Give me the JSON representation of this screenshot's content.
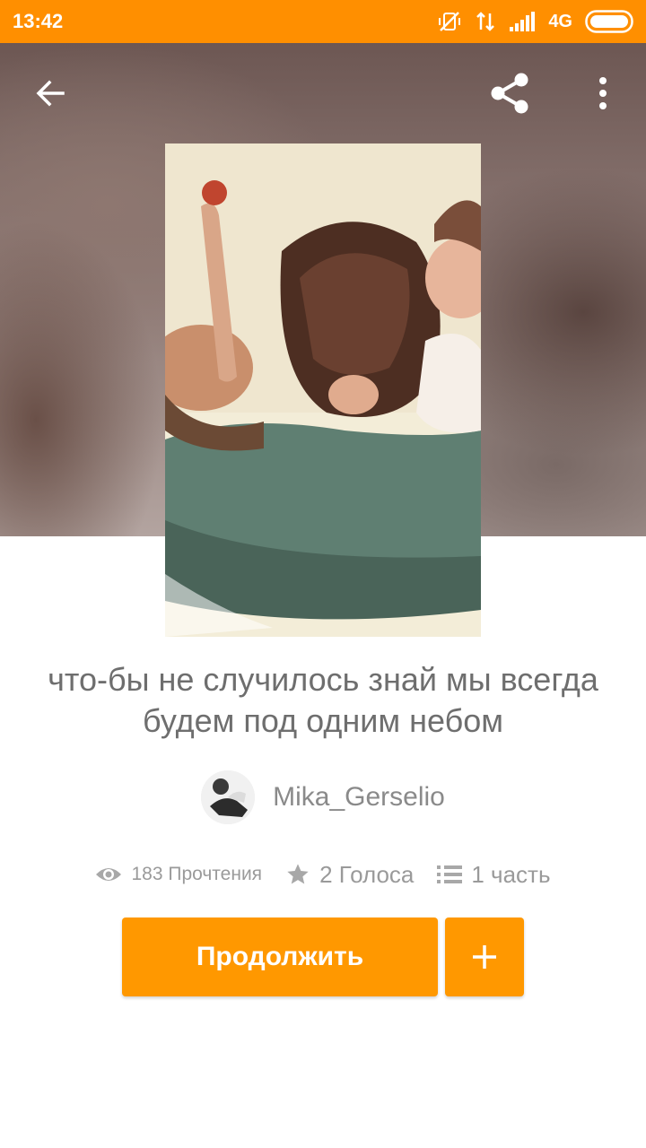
{
  "status_bar": {
    "time": "13:42",
    "network": "4G",
    "icons": [
      "vibrate-off-icon",
      "data-transfer-icon",
      "signal-icon",
      "battery-icon"
    ]
  },
  "toolbar": {
    "back_icon": "arrow-back-icon",
    "share_icon": "share-icon",
    "more_icon": "more-vert-icon"
  },
  "story": {
    "title": "что-бы не случилось знай мы всегда будем под одним небом",
    "author": "Mika_Gerselio",
    "reads": "183 Прочтения",
    "votes": "2 Голоса",
    "parts": "1 часть"
  },
  "actions": {
    "continue_label": "Продолжить",
    "add_icon": "plus-icon"
  },
  "colors": {
    "accent": "#ff9800",
    "status_bar": "#ff8f00",
    "title_text": "#6e6e6e",
    "meta_text": "#9a9a9a"
  }
}
